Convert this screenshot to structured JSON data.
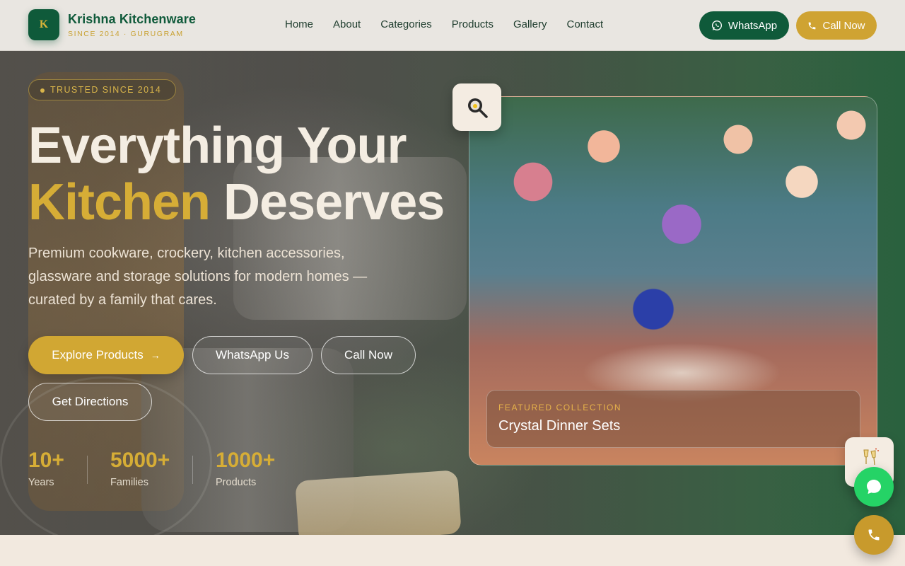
{
  "brand": {
    "logo_letter": "K",
    "name": "Krishna Kitchenware",
    "tagline": "SINCE 2014 · GURUGRAM",
    "colors": {
      "primary_green": "#0f5a3a",
      "gold": "#d1a733"
    }
  },
  "nav": {
    "items": [
      "Home",
      "About",
      "Categories",
      "Products",
      "Gallery",
      "Contact"
    ]
  },
  "header_actions": {
    "whatsapp_label": "WhatsApp",
    "whatsapp_icon": "whatsapp-icon",
    "call_label": "Call Now",
    "call_icon": "phone-icon"
  },
  "hero": {
    "badge": "TRUSTED SINCE 2014",
    "headline_line1": "Everything Your",
    "headline_gold": "Kitchen",
    "headline_rest": " Deserves",
    "lead": "Premium cookware, crockery, kitchen accessories, glassware and storage solutions for modern homes — curated by a family that cares.",
    "buttons": {
      "explore": "Explore Products",
      "explore_icon": "arrow-right-icon",
      "whatsapp": "WhatsApp Us",
      "call": "Call Now",
      "directions": "Get Directions"
    },
    "stats": [
      {
        "value": "10+",
        "label": "Years"
      },
      {
        "value": "5000+",
        "label": "Families"
      },
      {
        "value": "1000+",
        "label": "Products"
      }
    ]
  },
  "featured": {
    "kicker": "FEATURED COLLECTION",
    "title": "Crystal Dinner Sets",
    "search_icon": "frying-pan-magnifier-icon"
  },
  "floating": {
    "glass_icon": "champagne-glasses-icon",
    "chat_icon": "chat-bubble-icon",
    "phone_icon": "phone-icon"
  }
}
